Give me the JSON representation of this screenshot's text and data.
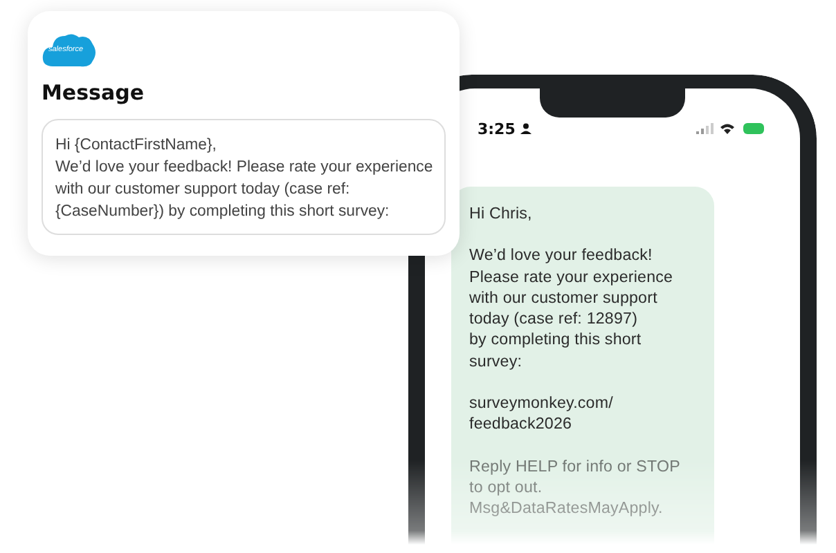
{
  "message_card": {
    "logo_text": "salesforce",
    "title": "Message",
    "template_lines": [
      "Hi {ContactFirstName},",
      "We’d love your feedback! Please rate your experience",
      "with our customer support today (case ref:",
      "{CaseNumber}) by completing this short survey:"
    ]
  },
  "phone": {
    "status_bar": {
      "time": "3:25"
    },
    "message_bubble": {
      "paragraphs": [
        {
          "kind": "body",
          "lines": [
            "Hi Chris,"
          ]
        },
        {
          "kind": "body",
          "lines": [
            "We’d love your feedback!",
            "Please rate your experience",
            "with our customer support",
            "today (case ref: 12897)",
            "by completing this short",
            "survey:"
          ]
        },
        {
          "kind": "body",
          "lines": [
            "surveymonkey.com/",
            "feedback2026"
          ]
        },
        {
          "kind": "footer",
          "lines": [
            "Reply HELP for info or STOP",
            "to opt out.",
            "Msg&DataRatesMayApply."
          ]
        }
      ]
    }
  }
}
